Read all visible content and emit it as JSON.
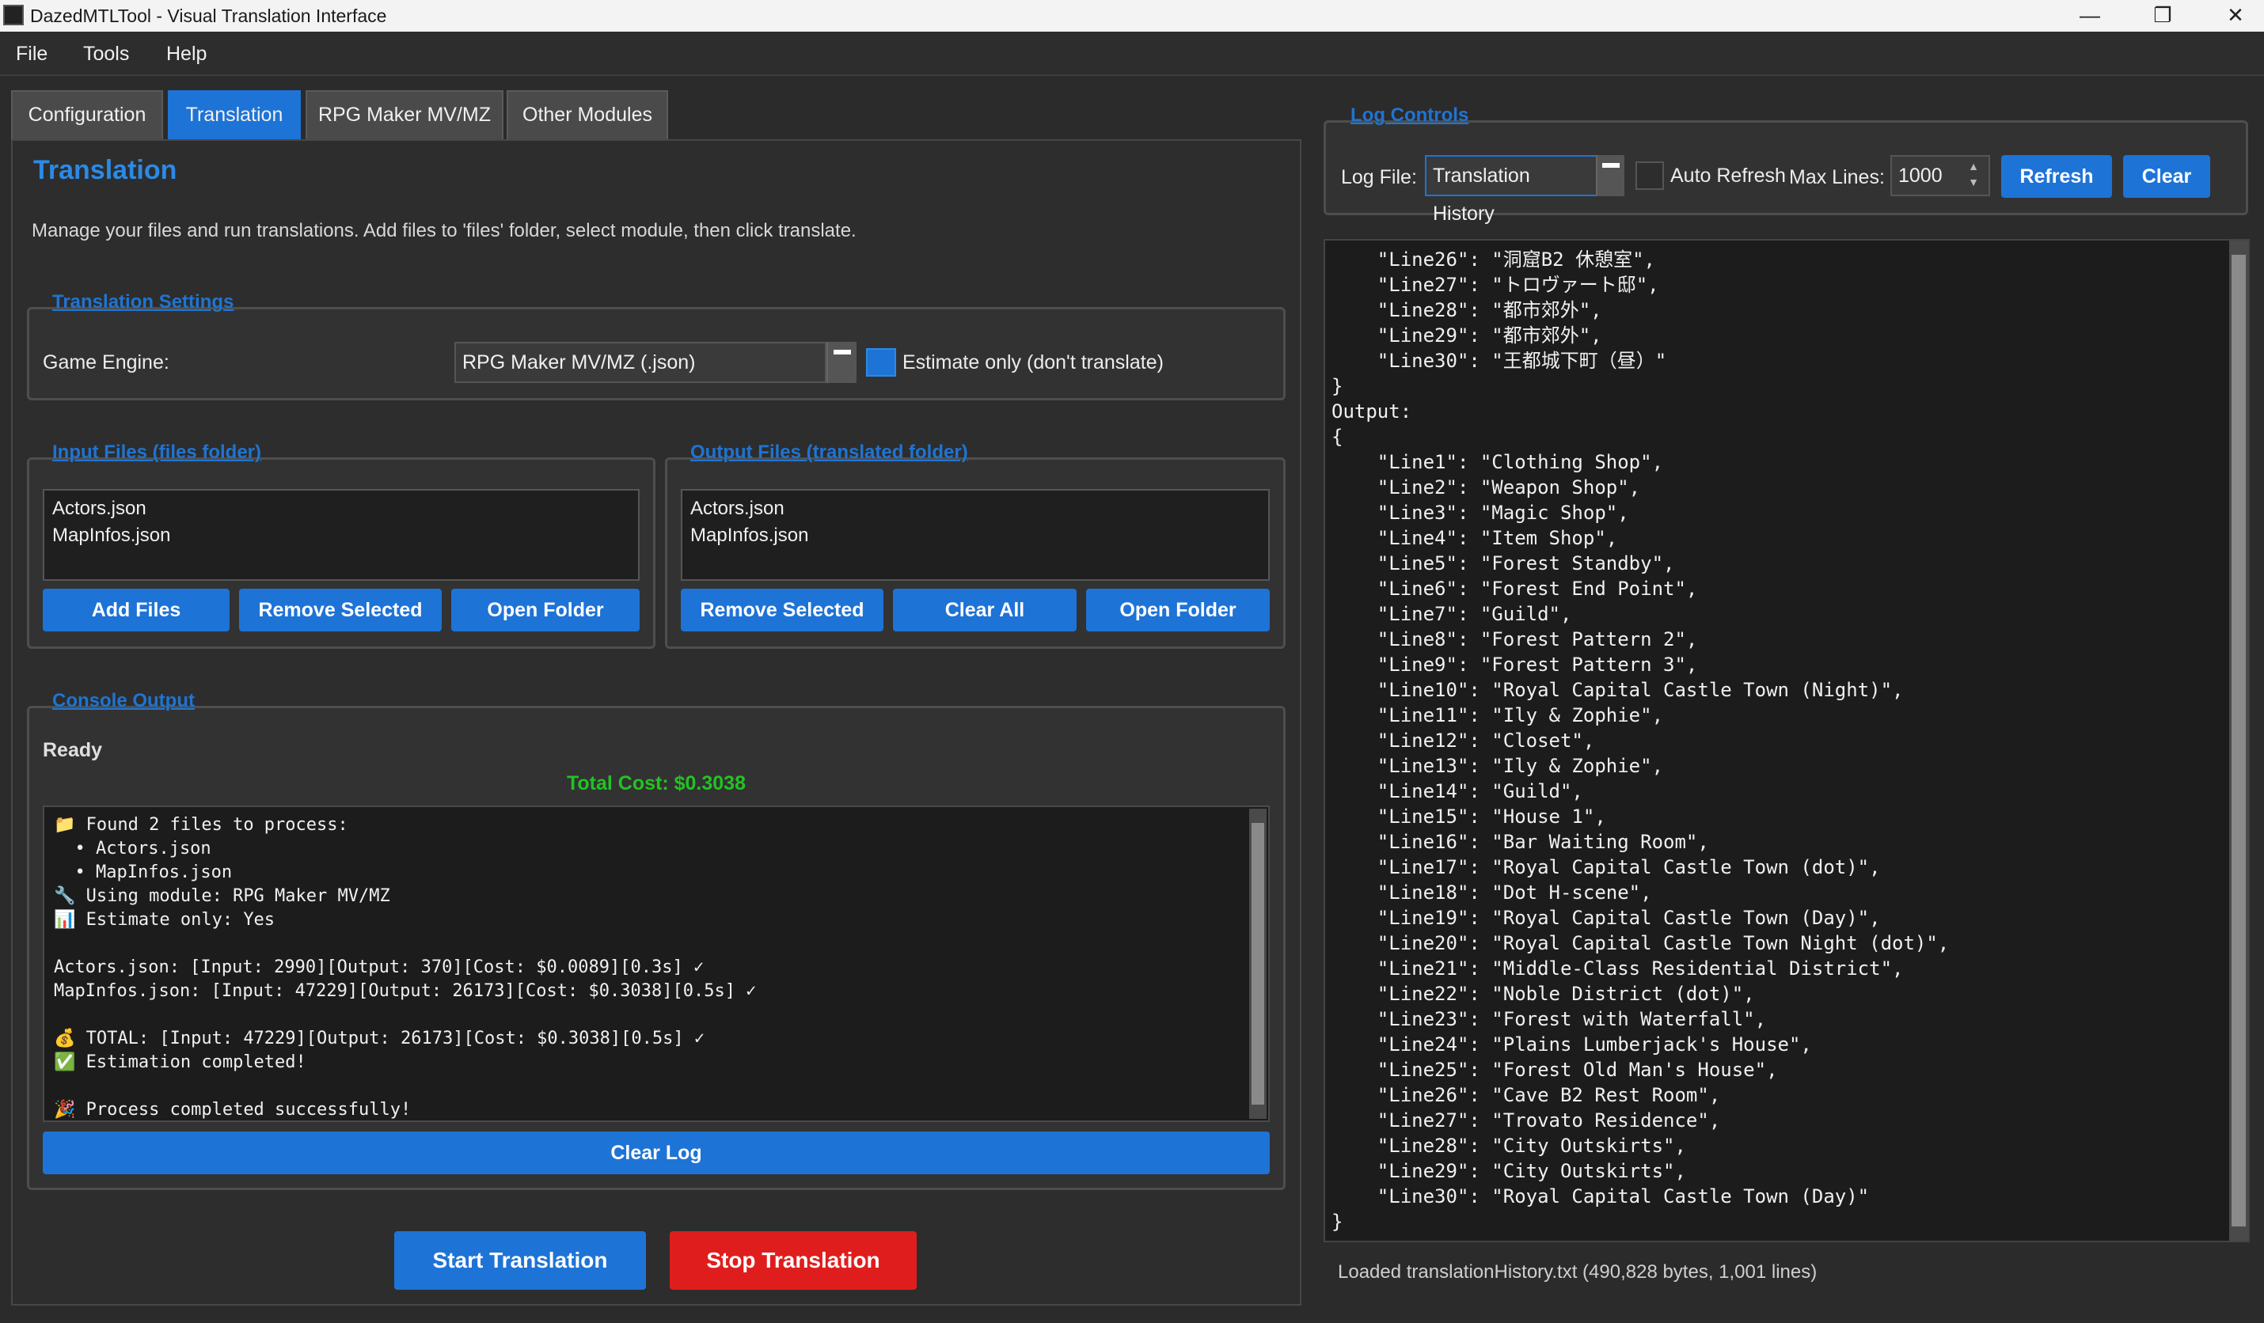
{
  "window": {
    "title": "DazedMTLTool - Visual Translation Interface"
  },
  "menu": [
    "File",
    "Tools",
    "Help"
  ],
  "tabs": [
    {
      "label": "Configuration",
      "active": false
    },
    {
      "label": "Translation",
      "active": true
    },
    {
      "label": "RPG Maker MV/MZ",
      "active": false
    },
    {
      "label": "Other Modules",
      "active": false
    }
  ],
  "page": {
    "title": "Translation",
    "description": "Manage your files and run translations. Add files to 'files' folder, select module, then click translate."
  },
  "settings": {
    "group_title": "Translation Settings",
    "engine_label": "Game Engine:",
    "engine_value": "RPG Maker MV/MZ (.json)",
    "estimate_label": "Estimate only (don't translate)",
    "estimate_checked": true
  },
  "input_files": {
    "group_title": "Input Files (files folder)",
    "items": [
      "Actors.json",
      "MapInfos.json"
    ],
    "buttons": [
      "Add Files",
      "Remove Selected",
      "Open Folder"
    ]
  },
  "output_files": {
    "group_title": "Output Files (translated folder)",
    "items": [
      "Actors.json",
      "MapInfos.json"
    ],
    "buttons": [
      "Remove Selected",
      "Clear All",
      "Open Folder"
    ]
  },
  "console": {
    "group_title": "Console Output",
    "status": "Ready",
    "total_cost": "Total Cost: $0.3038",
    "lines": [
      "📁 Found 2 files to process:",
      "  • Actors.json",
      "  • MapInfos.json",
      "🔧 Using module: RPG Maker MV/MZ",
      "📊 Estimate only: Yes",
      "",
      "Actors.json: [Input: 2990][Output: 370][Cost: $0.0089][0.3s] ✓",
      "MapInfos.json: [Input: 47229][Output: 26173][Cost: $0.3038][0.5s] ✓",
      "",
      "💰 TOTAL: [Input: 47229][Output: 26173][Cost: $0.3038][0.5s] ✓",
      "✅ Estimation completed!",
      "",
      "🎉 Process completed successfully!"
    ],
    "clear_label": "Clear Log"
  },
  "actions": {
    "start_label": "Start Translation",
    "stop_label": "Stop Translation"
  },
  "log_controls": {
    "group_title": "Log Controls",
    "file_label": "Log File:",
    "file_value": "Translation History",
    "auto_refresh_label": "Auto Refresh",
    "auto_refresh_checked": false,
    "max_lines_label": "Max Lines:",
    "max_lines_value": "1000",
    "refresh_label": "Refresh",
    "clear_label": "Clear"
  },
  "log": {
    "lines": [
      "    \"Line26\": \"洞窟B2 休憩室\",",
      "    \"Line27\": \"トロヴァート邸\",",
      "    \"Line28\": \"都市郊外\",",
      "    \"Line29\": \"都市郊外\",",
      "    \"Line30\": \"王都城下町（昼）\"",
      "}",
      "Output:",
      "{",
      "    \"Line1\": \"Clothing Shop\",",
      "    \"Line2\": \"Weapon Shop\",",
      "    \"Line3\": \"Magic Shop\",",
      "    \"Line4\": \"Item Shop\",",
      "    \"Line5\": \"Forest Standby\",",
      "    \"Line6\": \"Forest End Point\",",
      "    \"Line7\": \"Guild\",",
      "    \"Line8\": \"Forest Pattern 2\",",
      "    \"Line9\": \"Forest Pattern 3\",",
      "    \"Line10\": \"Royal Capital Castle Town (Night)\",",
      "    \"Line11\": \"Ily & Zophie\",",
      "    \"Line12\": \"Closet\",",
      "    \"Line13\": \"Ily & Zophie\",",
      "    \"Line14\": \"Guild\",",
      "    \"Line15\": \"House 1\",",
      "    \"Line16\": \"Bar Waiting Room\",",
      "    \"Line17\": \"Royal Capital Castle Town (dot)\",",
      "    \"Line18\": \"Dot H-scene\",",
      "    \"Line19\": \"Royal Capital Castle Town (Day)\",",
      "    \"Line20\": \"Royal Capital Castle Town Night (dot)\",",
      "    \"Line21\": \"Middle-Class Residential District\",",
      "    \"Line22\": \"Noble District (dot)\",",
      "    \"Line23\": \"Forest with Waterfall\",",
      "    \"Line24\": \"Plains Lumberjack's House\",",
      "    \"Line25\": \"Forest Old Man's House\",",
      "    \"Line26\": \"Cave B2 Rest Room\",",
      "    \"Line27\": \"Trovato Residence\",",
      "    \"Line28\": \"City Outskirts\",",
      "    \"Line29\": \"City Outskirts\",",
      "    \"Line30\": \"Royal Capital Castle Town (Day)\"",
      "}"
    ],
    "status": "Loaded translationHistory.txt (490,828 bytes, 1,001 lines)"
  }
}
